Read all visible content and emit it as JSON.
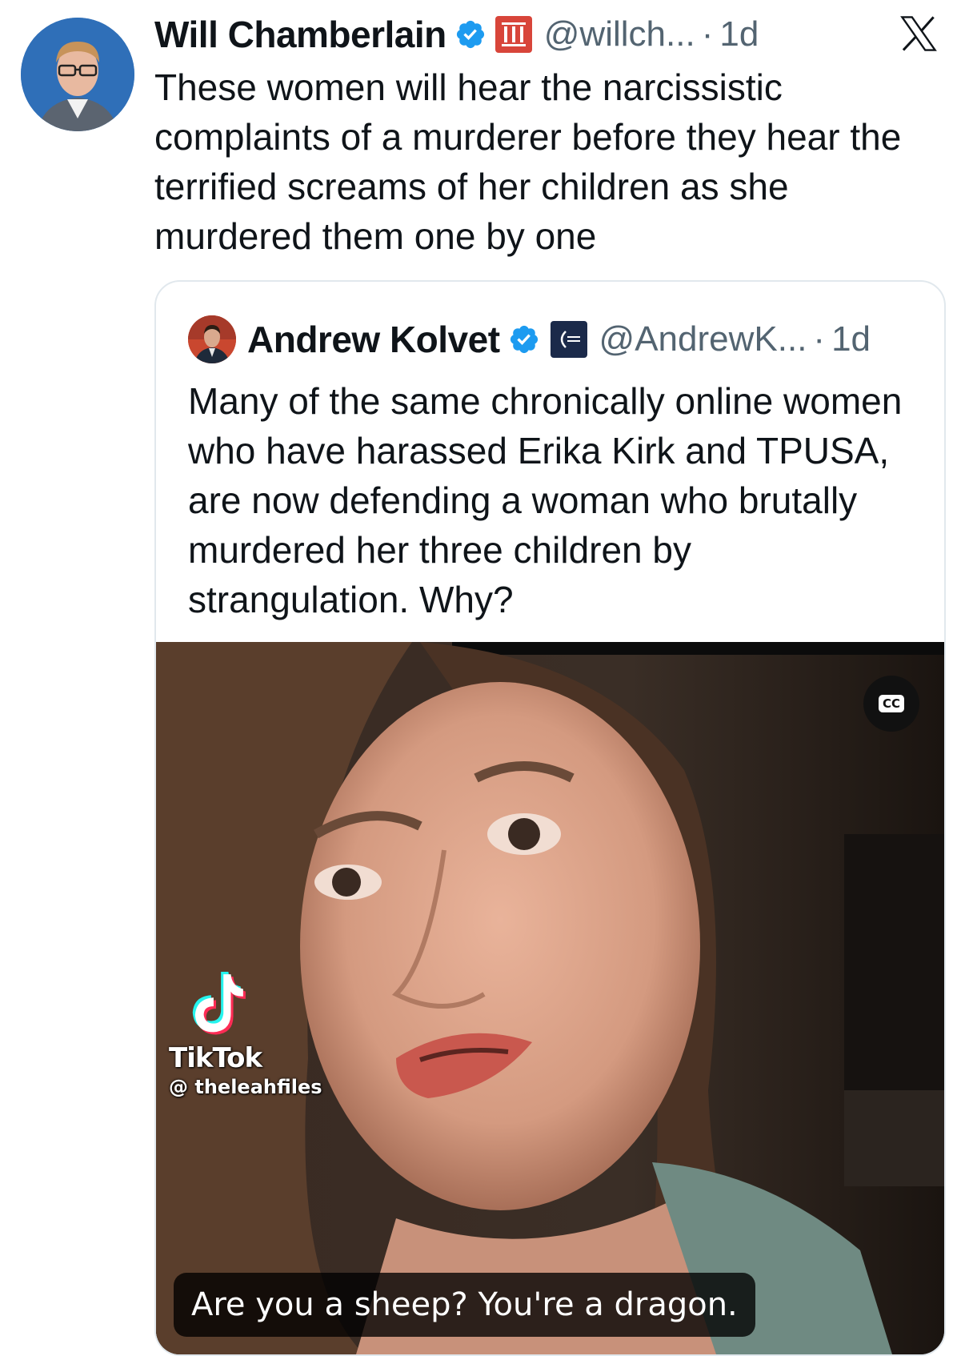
{
  "tweet": {
    "author_name": "Will Chamberlain",
    "handle": "@willch...",
    "dot": "·",
    "time": "1d",
    "text": "These women will hear the narcissistic complaints of a murderer before they hear the terrified screams of her children as she murdered them one by one"
  },
  "quoted_tweet": {
    "author_name": "Andrew Kolvet",
    "handle": "@AndrewK...",
    "dot": "·",
    "time": "1d",
    "text": "Many of the same chronically online women who have harassed Erika Kirk and TPUSA, are now defending a woman who brutally murdered her three children by strangulation. Why?",
    "video": {
      "cc_label": "CC",
      "watermark_brand": "TikTok",
      "watermark_user": "@ theleahfiles",
      "caption": "Are you a sheep? You're a dragon."
    }
  },
  "icons": {
    "verified": "verified-badge-icon",
    "affiliation_main": "affiliate-badge-icon",
    "affiliation_quote": "turning-point-badge-icon",
    "x_logo": "x-logo-icon",
    "tiktok": "tiktok-icon"
  },
  "colors": {
    "verified_blue": "#1d9bf0",
    "muted_text": "#536471",
    "text": "#0f1419",
    "affil_red": "#d8453a",
    "affil_navy": "#1b2a4a"
  }
}
